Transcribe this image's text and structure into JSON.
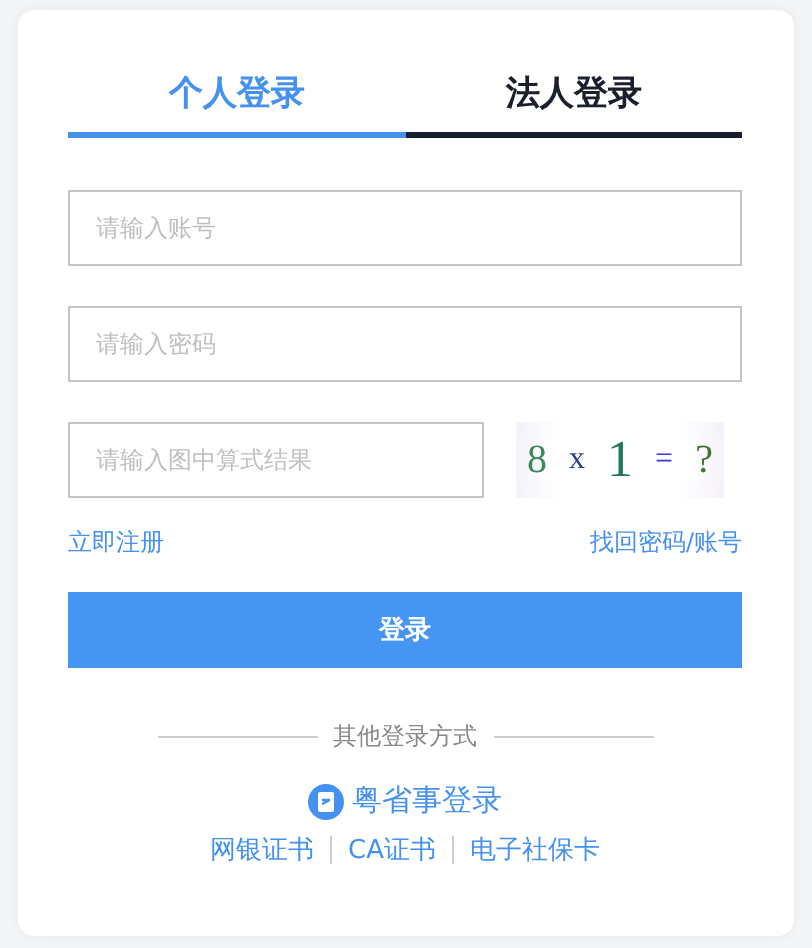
{
  "tabs": [
    {
      "label": "个人登录",
      "selected": true
    },
    {
      "label": "法人登录",
      "selected": false
    }
  ],
  "fields": [
    {
      "placeholder": "请输入账号"
    },
    {
      "placeholder": "请输入密码"
    }
  ],
  "captcha_field": {
    "placeholder": "请输入图中算式结果"
  },
  "captcha": [
    "8",
    "x",
    "1",
    "=",
    "?"
  ],
  "links": {
    "register": "立即注册",
    "recover": "找回密码/账号"
  },
  "login_button": "登录",
  "other_methods": {
    "title": "其他登录方式",
    "primary": "粤省事登录",
    "options": [
      "网银证书",
      "CA证书",
      "电子社保卡"
    ]
  }
}
